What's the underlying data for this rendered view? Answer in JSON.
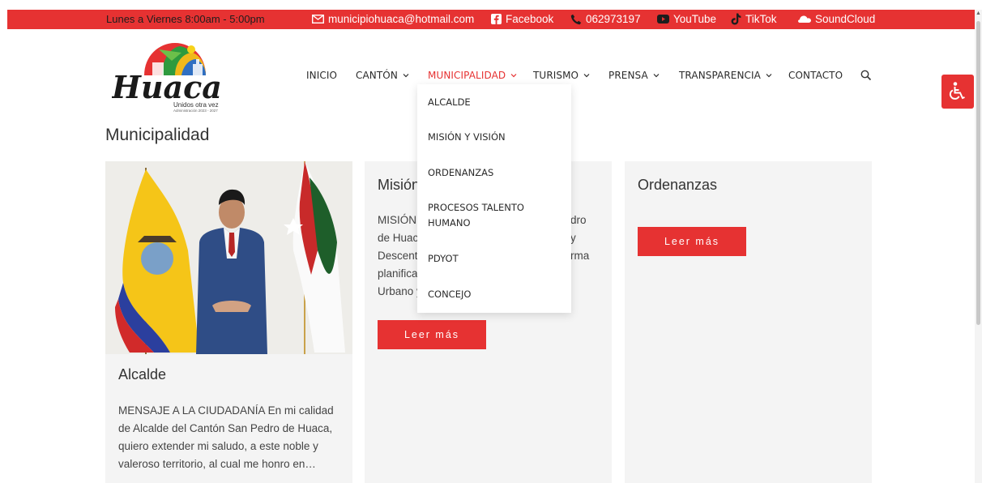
{
  "topbar": {
    "hours": "Lunes a Viernes 8:00am - 5:00pm",
    "email": "municipiohuaca@hotmail.com",
    "facebook": "Facebook",
    "phone": "062973197",
    "youtube": "YouTube",
    "tiktok": "TikTok",
    "soundcloud": "SoundCloud"
  },
  "logo": {
    "name": "Huaca",
    "tagline": "Unidos otra vez",
    "period": "Administración 2023 - 2027"
  },
  "nav": {
    "items": [
      {
        "label": "INICIO"
      },
      {
        "label": "CANTÓN"
      },
      {
        "label": "MUNICIPALIDAD"
      },
      {
        "label": "TURISMO"
      },
      {
        "label": "PRENSA"
      },
      {
        "label": "TRANSPARENCIA"
      },
      {
        "label": "CONTACTO"
      }
    ],
    "dropdown": [
      "ALCALDE",
      "MISIÓN Y VISIÓN",
      "ORDENANZAS",
      "PROCESOS TALENTO HUMANO",
      "PDYOT",
      "CONCEJO"
    ]
  },
  "page": {
    "title": "Municipalidad"
  },
  "cards": [
    {
      "title": "Alcalde",
      "text": "MENSAJE A LA CIUDADANÍA En mi calidad de Alcalde del Cantón San Pedro de Huaca, quiero extender mi saludo, a este noble y valeroso territorio, al cual me honro en…"
    },
    {
      "title": "Misión",
      "text_lines": [
        "MISIÓN",
        "de Huac",
        "Descent",
        "planifica",
        "Urbano y"
      ],
      "text_right": [
        "dro",
        "y",
        "rma"
      ],
      "button": "Leer más"
    },
    {
      "title": "Ordenanzas",
      "button": "Leer más"
    }
  ],
  "colors": {
    "brand": "#e63232"
  }
}
